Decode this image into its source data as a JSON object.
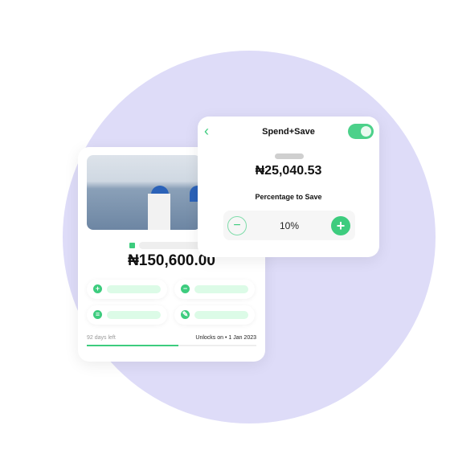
{
  "colors": {
    "accent": "#3dcc7e",
    "background_circle": "#dedcf8"
  },
  "wallet_card": {
    "balance": "₦150,600.00",
    "actions": [
      {
        "icon": "plus-icon",
        "glyph": "+"
      },
      {
        "icon": "minus-icon",
        "glyph": "−"
      },
      {
        "icon": "card-icon",
        "glyph": "≡"
      },
      {
        "icon": "pencil-icon",
        "glyph": "✎"
      }
    ],
    "days_left": "92 days left",
    "unlocks": "Unlocks on • 1 Jan 2023",
    "progress_percent": 54
  },
  "spend_save": {
    "back_glyph": "‹",
    "title": "Spend+Save",
    "toggle_on": true,
    "amount": "₦25,040.53",
    "percentage_label": "Percentage to Save",
    "percentage_value": "10%",
    "minus_glyph": "−",
    "plus_glyph": "+"
  }
}
